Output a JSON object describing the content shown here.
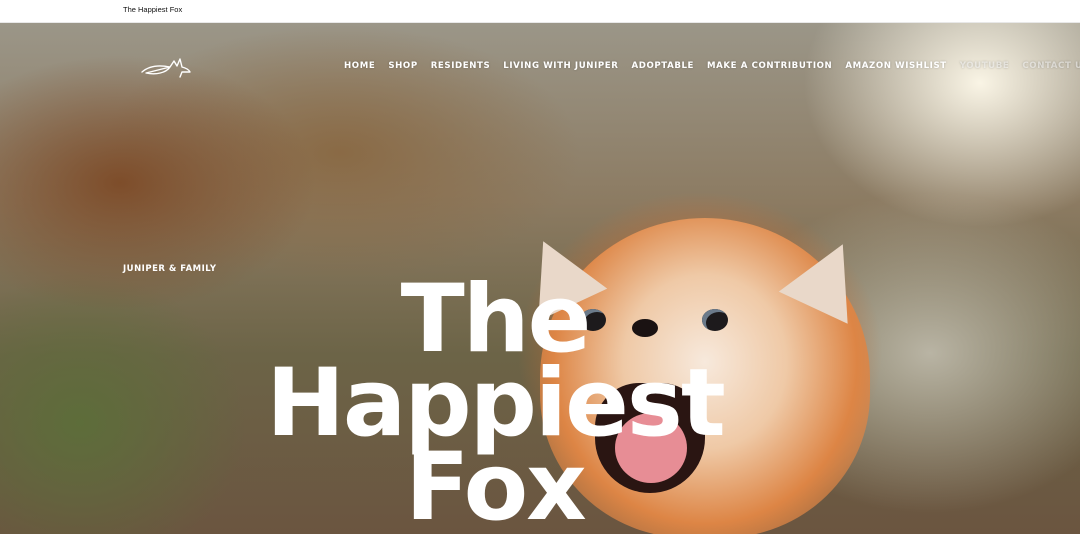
{
  "tab": {
    "title": "The Happiest Fox"
  },
  "nav": {
    "items": [
      {
        "label": "HOME"
      },
      {
        "label": "SHOP"
      },
      {
        "label": "RESIDENTS"
      },
      {
        "label": "LIVING WITH JUNIPER"
      },
      {
        "label": "ADOPTABLE"
      },
      {
        "label": "MAKE A CONTRIBUTION"
      },
      {
        "label": "AMAZON WISHLIST"
      },
      {
        "label": "YOUTUBE"
      },
      {
        "label": "CONTACT US"
      }
    ]
  },
  "hero": {
    "kicker": "JUNIPER & FAMILY",
    "headline_line1": "The Happiest",
    "headline_line2": "Fox"
  },
  "icons": {
    "logo": "fox-logo-icon"
  },
  "colors": {
    "text": "#ffffff",
    "topbar": "#ffffff"
  }
}
